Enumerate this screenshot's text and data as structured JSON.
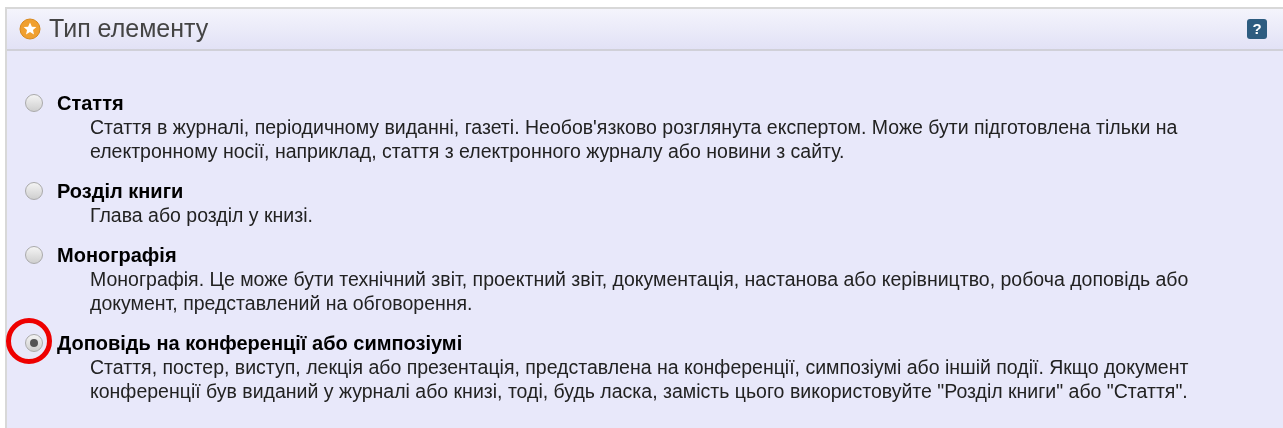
{
  "panel": {
    "title": "Тип елементу",
    "help": "?"
  },
  "options": [
    {
      "title": "Стаття",
      "description": "Стаття в журналі, періодичному виданні, газеті. Необов'язково розглянута експертом. Може бути підготовлена тільки на електронному носії, наприклад, стаття з електронного журналу або новини з сайту.",
      "selected": false,
      "circled": false
    },
    {
      "title": "Розділ книги",
      "description": "Глава або розділ у книзі.",
      "selected": false,
      "circled": false
    },
    {
      "title": "Монографія",
      "description": "Монографія. Це може бути технічний звіт, проектний звіт, документація, настанова або керівництво, робоча доповідь або документ, представлений на обговорення.",
      "selected": false,
      "circled": false
    },
    {
      "title": "Доповідь на конференції або симпозіумі",
      "description": "Стаття, постер, виступ, лекція або презентація, представлена на конференції, симпозіумі або іншій події. Якщо документ конференції був виданий у журналі або книзі, тоді, будь ласка, замість цього використовуйте \"Розділ книги\" або \"Стаття\".",
      "selected": true,
      "circled": true
    }
  ]
}
